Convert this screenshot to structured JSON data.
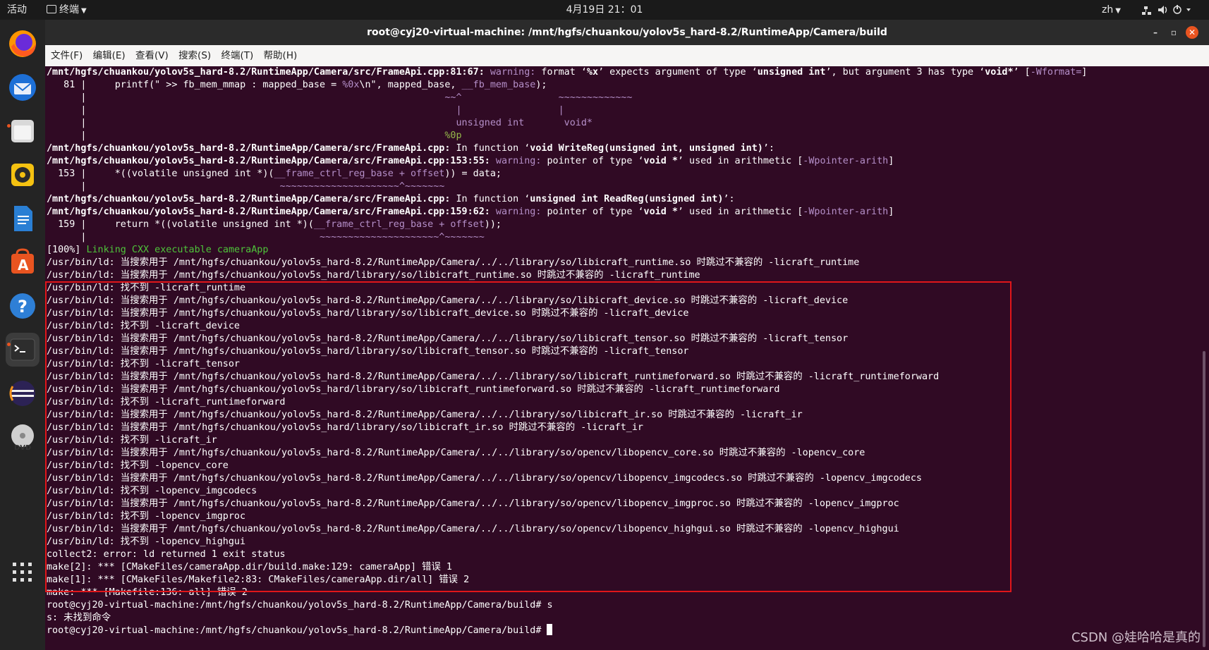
{
  "topbar": {
    "activities": "活动",
    "app_menu": "终端",
    "clock": "4月19日  21：01",
    "language": "zh"
  },
  "window": {
    "title": "root@cyj20-virtual-machine: /mnt/hgfs/chuankou/yolov5s_hard-8.2/RuntimeApp/Camera/build"
  },
  "menu": [
    "文件(F)",
    "编辑(E)",
    "查看(V)",
    "搜索(S)",
    "终端(T)",
    "帮助(H)"
  ],
  "terminal": {
    "lines": [
      [
        [
          "b",
          "/mnt/hgfs/chuankou/yolov5s_hard-8.2/RuntimeApp/Camera/src/FrameApi.cpp:81:67: "
        ],
        [
          "warn",
          "warning: "
        ],
        [
          "",
          "format ‘"
        ],
        [
          "b",
          "%x"
        ],
        [
          "",
          "’ expects argument of type ‘"
        ],
        [
          "b",
          "unsigned int"
        ],
        [
          "",
          "’, but argument 3 has type ‘"
        ],
        [
          "b",
          "void*"
        ],
        [
          "",
          "’ ["
        ],
        [
          "warn",
          "-Wformat="
        ],
        [
          "",
          "]"
        ]
      ],
      [
        [
          "",
          "   81 |     printf(\" >> fb_mem_mmap : mapped_base = "
        ],
        [
          "warn",
          "%0x"
        ],
        [
          "",
          "\\n\", mapped_base, "
        ],
        [
          "warn",
          "__fb_mem_base"
        ],
        [
          "",
          ");"
        ]
      ],
      [
        [
          "",
          "      |                                                               "
        ],
        [
          "warn",
          "~~^"
        ],
        [
          "",
          "                 "
        ],
        [
          "warn",
          "~~~~~~~~~~~~~"
        ]
      ],
      [
        [
          "",
          "      |                                                                 "
        ],
        [
          "warn",
          "|"
        ],
        [
          "",
          "                 "
        ],
        [
          "warn",
          "|"
        ]
      ],
      [
        [
          "",
          "      |                                                                 "
        ],
        [
          "warn",
          "unsigned int"
        ],
        [
          "",
          "       "
        ],
        [
          "warn",
          "void*"
        ]
      ],
      [
        [
          "",
          "      |                                                               "
        ],
        [
          "olive",
          "%0p"
        ]
      ],
      [
        [
          "b",
          "/mnt/hgfs/chuankou/yolov5s_hard-8.2/RuntimeApp/Camera/src/FrameApi.cpp:"
        ],
        [
          "",
          " In function ‘"
        ],
        [
          "b",
          "void WriteReg(unsigned int, unsigned int)"
        ],
        [
          "",
          "’:"
        ]
      ],
      [
        [
          "b",
          "/mnt/hgfs/chuankou/yolov5s_hard-8.2/RuntimeApp/Camera/src/FrameApi.cpp:153:55: "
        ],
        [
          "warn",
          "warning: "
        ],
        [
          "",
          "pointer of type ‘"
        ],
        [
          "b",
          "void *"
        ],
        [
          "",
          "’ used in arithmetic ["
        ],
        [
          "warn",
          "-Wpointer-arith"
        ],
        [
          "",
          "]"
        ]
      ],
      [
        [
          "",
          "  153 |     *((volatile unsigned int *)("
        ],
        [
          "warn",
          "__frame_ctrl_reg_base + offset"
        ],
        [
          "",
          ")) = data;"
        ]
      ],
      [
        [
          "",
          "      |                                  "
        ],
        [
          "warn",
          "~~~~~~~~~~~~~~~~~~~~~^~~~~~~~"
        ]
      ],
      [
        [
          "b",
          "/mnt/hgfs/chuankou/yolov5s_hard-8.2/RuntimeApp/Camera/src/FrameApi.cpp:"
        ],
        [
          "",
          " In function ‘"
        ],
        [
          "b",
          "unsigned int ReadReg(unsigned int)"
        ],
        [
          "",
          "’:"
        ]
      ],
      [
        [
          "b",
          "/mnt/hgfs/chuankou/yolov5s_hard-8.2/RuntimeApp/Camera/src/FrameApi.cpp:159:62: "
        ],
        [
          "warn",
          "warning: "
        ],
        [
          "",
          "pointer of type ‘"
        ],
        [
          "b",
          "void *"
        ],
        [
          "",
          "’ used in arithmetic ["
        ],
        [
          "warn",
          "-Wpointer-arith"
        ],
        [
          "",
          "]"
        ]
      ],
      [
        [
          "",
          "  159 |     return *((volatile unsigned int *)("
        ],
        [
          "warn",
          "__frame_ctrl_reg_base + offset"
        ],
        [
          "",
          "));"
        ]
      ],
      [
        [
          "",
          "      |                                         "
        ],
        [
          "warn",
          "~~~~~~~~~~~~~~~~~~~~~^~~~~~~~"
        ]
      ],
      [
        [
          "",
          "[100%] "
        ],
        [
          "grn",
          "Linking CXX executable cameraApp"
        ]
      ],
      [
        [
          "",
          "/usr/bin/ld: 当搜索用于 /mnt/hgfs/chuankou/yolov5s_hard-8.2/RuntimeApp/Camera/../../library/so/libicraft_runtime.so 时跳过不兼容的 -licraft_runtime"
        ]
      ],
      [
        [
          "",
          "/usr/bin/ld: 当搜索用于 /mnt/hgfs/chuankou/yolov5s_hard/library/so/libicraft_runtime.so 时跳过不兼容的 -licraft_runtime"
        ]
      ],
      [
        [
          "",
          "/usr/bin/ld: 找不到 -licraft_runtime"
        ]
      ],
      [
        [
          "",
          "/usr/bin/ld: 当搜索用于 /mnt/hgfs/chuankou/yolov5s_hard-8.2/RuntimeApp/Camera/../../library/so/libicraft_device.so 时跳过不兼容的 -licraft_device"
        ]
      ],
      [
        [
          "",
          "/usr/bin/ld: 当搜索用于 /mnt/hgfs/chuankou/yolov5s_hard/library/so/libicraft_device.so 时跳过不兼容的 -licraft_device"
        ]
      ],
      [
        [
          "",
          "/usr/bin/ld: 找不到 -licraft_device"
        ]
      ],
      [
        [
          "",
          "/usr/bin/ld: 当搜索用于 /mnt/hgfs/chuankou/yolov5s_hard-8.2/RuntimeApp/Camera/../../library/so/libicraft_tensor.so 时跳过不兼容的 -licraft_tensor"
        ]
      ],
      [
        [
          "",
          "/usr/bin/ld: 当搜索用于 /mnt/hgfs/chuankou/yolov5s_hard/library/so/libicraft_tensor.so 时跳过不兼容的 -licraft_tensor"
        ]
      ],
      [
        [
          "",
          "/usr/bin/ld: 找不到 -licraft_tensor"
        ]
      ],
      [
        [
          "",
          "/usr/bin/ld: 当搜索用于 /mnt/hgfs/chuankou/yolov5s_hard-8.2/RuntimeApp/Camera/../../library/so/libicraft_runtimeforward.so 时跳过不兼容的 -licraft_runtimeforward"
        ]
      ],
      [
        [
          "",
          "/usr/bin/ld: 当搜索用于 /mnt/hgfs/chuankou/yolov5s_hard/library/so/libicraft_runtimeforward.so 时跳过不兼容的 -licraft_runtimeforward"
        ]
      ],
      [
        [
          "",
          "/usr/bin/ld: 找不到 -licraft_runtimeforward"
        ]
      ],
      [
        [
          "",
          "/usr/bin/ld: 当搜索用于 /mnt/hgfs/chuankou/yolov5s_hard-8.2/RuntimeApp/Camera/../../library/so/libicraft_ir.so 时跳过不兼容的 -licraft_ir"
        ]
      ],
      [
        [
          "",
          "/usr/bin/ld: 当搜索用于 /mnt/hgfs/chuankou/yolov5s_hard/library/so/libicraft_ir.so 时跳过不兼容的 -licraft_ir"
        ]
      ],
      [
        [
          "",
          "/usr/bin/ld: 找不到 -licraft_ir"
        ]
      ],
      [
        [
          "",
          "/usr/bin/ld: 当搜索用于 /mnt/hgfs/chuankou/yolov5s_hard-8.2/RuntimeApp/Camera/../../library/so/opencv/libopencv_core.so 时跳过不兼容的 -lopencv_core"
        ]
      ],
      [
        [
          "",
          "/usr/bin/ld: 找不到 -lopencv_core"
        ]
      ],
      [
        [
          "",
          "/usr/bin/ld: 当搜索用于 /mnt/hgfs/chuankou/yolov5s_hard-8.2/RuntimeApp/Camera/../../library/so/opencv/libopencv_imgcodecs.so 时跳过不兼容的 -lopencv_imgcodecs"
        ]
      ],
      [
        [
          "",
          "/usr/bin/ld: 找不到 -lopencv_imgcodecs"
        ]
      ],
      [
        [
          "",
          "/usr/bin/ld: 当搜索用于 /mnt/hgfs/chuankou/yolov5s_hard-8.2/RuntimeApp/Camera/../../library/so/opencv/libopencv_imgproc.so 时跳过不兼容的 -lopencv_imgproc"
        ]
      ],
      [
        [
          "",
          "/usr/bin/ld: 找不到 -lopencv_imgproc"
        ]
      ],
      [
        [
          "",
          "/usr/bin/ld: 当搜索用于 /mnt/hgfs/chuankou/yolov5s_hard-8.2/RuntimeApp/Camera/../../library/so/opencv/libopencv_highgui.so 时跳过不兼容的 -lopencv_highgui"
        ]
      ],
      [
        [
          "",
          "/usr/bin/ld: 找不到 -lopencv_highgui"
        ]
      ],
      [
        [
          "",
          "collect2: error: ld returned 1 exit status"
        ]
      ],
      [
        [
          "",
          "make[2]: *** [CMakeFiles/cameraApp.dir/build.make:129: cameraApp] 错误 1"
        ]
      ],
      [
        [
          "",
          "make[1]: *** [CMakeFiles/Makefile2:83: CMakeFiles/cameraApp.dir/all] 错误 2"
        ]
      ],
      [
        [
          "",
          "make: *** [Makefile:136: all] 错误 2"
        ]
      ],
      [
        [
          "",
          "root@cyj20-virtual-machine:/mnt/hgfs/chuankou/yolov5s_hard-8.2/RuntimeApp/Camera/build# s"
        ]
      ],
      [
        [
          "",
          "s: 未找到命令"
        ]
      ],
      [
        [
          "",
          "root@cyj20-virtual-machine:/mnt/hgfs/chuankou/yolov5s_hard-8.2/RuntimeApp/Camera/build# "
        ]
      ]
    ]
  },
  "dock": {
    "items": [
      "firefox-icon",
      "thunderbird-icon",
      "files-icon",
      "rhythmbox-icon",
      "libreoffice-writer-icon",
      "software-center-icon",
      "help-icon",
      "terminal-icon",
      "eclipse-icon",
      "dvd-icon"
    ],
    "show_apps": "show-applications-icon"
  },
  "watermark": "CSDN @娃哈哈是真的",
  "colors": {
    "terminal_bg": "#300a24",
    "warning": "#b58fc9",
    "linking": "#4ec43a",
    "highlight_box": "#e0161a",
    "ubuntu_orange": "#e95420"
  }
}
